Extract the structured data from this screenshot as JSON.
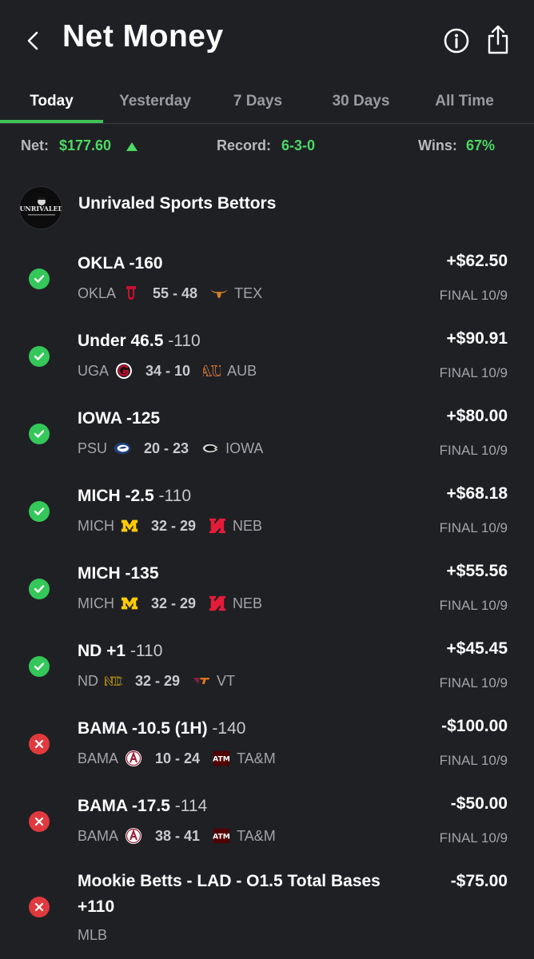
{
  "header": {
    "title": "Net Money"
  },
  "tabs": [
    {
      "label": "Today",
      "active": true
    },
    {
      "label": "Yesterday",
      "active": false
    },
    {
      "label": "7 Days",
      "active": false
    },
    {
      "label": "30 Days",
      "active": false
    },
    {
      "label": "All Time",
      "active": false
    }
  ],
  "summary": {
    "net_label": "Net:",
    "net_value": "$177.60",
    "record_label": "Record:",
    "record_value": "6-3-0",
    "wins_label": "Wins:",
    "wins_value": "67%"
  },
  "group": {
    "name": "Unrivaled Sports Bettors",
    "avatar_text": "UNRIVALED"
  },
  "colors": {
    "win": "#34c759",
    "loss": "#e0393e",
    "accent": "#4cd964"
  },
  "bets": [
    {
      "status": "win",
      "pick": "OKLA -160",
      "odds": "",
      "team1": "OKLA",
      "logo1": "oklahoma-logo",
      "score": "55 - 48",
      "logo2": "texas-logo",
      "team2": "TEX",
      "amount": "+$62.50",
      "final": "FINAL 10/9"
    },
    {
      "status": "win",
      "pick": "Under 46.5",
      "odds": " -110",
      "team1": "UGA",
      "logo1": "georgia-logo",
      "score": "34 - 10",
      "logo2": "auburn-logo",
      "team2": "AUB",
      "amount": "+$90.91",
      "final": "FINAL 10/9"
    },
    {
      "status": "win",
      "pick": "IOWA -125",
      "odds": "",
      "team1": "PSU",
      "logo1": "penn-state-logo",
      "score": "20 - 23",
      "logo2": "iowa-logo",
      "team2": "IOWA",
      "amount": "+$80.00",
      "final": "FINAL 10/9"
    },
    {
      "status": "win",
      "pick": "MICH -2.5",
      "odds": " -110",
      "team1": "MICH",
      "logo1": "michigan-logo",
      "score": "32 - 29",
      "logo2": "nebraska-logo",
      "team2": "NEB",
      "amount": "+$68.18",
      "final": "FINAL 10/9"
    },
    {
      "status": "win",
      "pick": "MICH -135",
      "odds": "",
      "team1": "MICH",
      "logo1": "michigan-logo",
      "score": "32 - 29",
      "logo2": "nebraska-logo",
      "team2": "NEB",
      "amount": "+$55.56",
      "final": "FINAL 10/9"
    },
    {
      "status": "win",
      "pick": "ND +1",
      "odds": " -110",
      "team1": "ND",
      "logo1": "notre-dame-logo",
      "score": "32 - 29",
      "logo2": "virginia-tech-logo",
      "team2": "VT",
      "amount": "+$45.45",
      "final": "FINAL 10/9"
    },
    {
      "status": "loss",
      "pick": "BAMA -10.5 (1H)",
      "odds": " -140",
      "team1": "BAMA",
      "logo1": "alabama-logo",
      "score": "10 - 24",
      "logo2": "texas-am-logo",
      "team2": "TA&M",
      "amount": "-$100.00",
      "final": "FINAL 10/9"
    },
    {
      "status": "loss",
      "pick": "BAMA -17.5",
      "odds": " -114",
      "team1": "BAMA",
      "logo1": "alabama-logo",
      "score": "38 - 41",
      "logo2": "texas-am-logo",
      "team2": "TA&M",
      "amount": "-$50.00",
      "final": "FINAL 10/9"
    }
  ],
  "last_bet": {
    "status": "loss",
    "pick_line1": "Mookie Betts - LAD - O1.5 Total Bases",
    "pick_line2": "+110",
    "league": "MLB",
    "amount": "-$75.00"
  }
}
